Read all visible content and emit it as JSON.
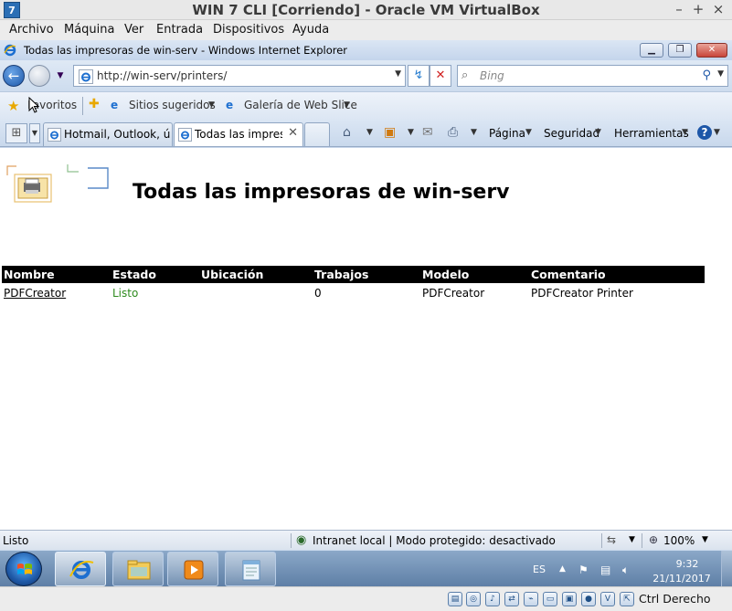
{
  "host": {
    "title": "WIN 7 CLI [Corriendo] - Oracle VM VirtualBox",
    "logo_text": "7",
    "controls": {
      "minimize": "–",
      "maximize": "+",
      "close": "×"
    },
    "menu": [
      "Archivo",
      "Máquina",
      "Ver",
      "Entrada",
      "Dispositivos",
      "Ayuda"
    ],
    "status_icons": [
      "hard-disk-icon",
      "optical-drive-icon",
      "audio-icon",
      "network-icon",
      "usb-icon",
      "shared-folders-icon",
      "display-icon",
      "video-capture-icon",
      "cpu-icon",
      "mouse-integration-icon",
      "keyboard-icon"
    ],
    "host_key": "Ctrl Derecho"
  },
  "ie": {
    "window_title": "Todas las impresoras de win-serv - Windows Internet Explorer",
    "address": "http://win-serv/printers/",
    "search_placeholder": "Bing",
    "favorites": {
      "label": "Favoritos",
      "suggested_sites": "Sitios sugeridos",
      "web_slice_gallery": "Galería de Web Slice"
    },
    "tabs": [
      {
        "label": "Hotmail, Outlook, ú...",
        "active": false
      },
      {
        "label": "Todas las impres...",
        "active": true
      }
    ],
    "commands": {
      "page": "Página",
      "security": "Seguridad",
      "tools": "Herramientas",
      "help": "?"
    },
    "status": {
      "text": "Listo",
      "zone": "Intranet local | Modo protegido: desactivado",
      "zoom": "100%"
    }
  },
  "page": {
    "heading": "Todas las impresoras de win-serv",
    "table": {
      "columns": [
        "Nombre",
        "Estado",
        "Ubicación",
        "Trabajos",
        "Modelo",
        "Comentario"
      ],
      "rows": [
        {
          "name": "PDFCreator",
          "status": "Listo",
          "location": "",
          "jobs": "0",
          "model": "PDFCreator",
          "comment": "PDFCreator Printer"
        }
      ]
    }
  },
  "taskbar": {
    "pinned": [
      "internet-explorer",
      "windows-explorer",
      "media-player",
      "notepad"
    ],
    "active": "internet-explorer",
    "tray": {
      "language": "ES",
      "time": "9:32",
      "date": "21/11/2017"
    }
  },
  "colors": {
    "status_ok": "#2e8b1e",
    "table_header_bg": "#000000",
    "ie_chrome": "#c8d8ec",
    "taskbar": "#5e7fa6"
  }
}
